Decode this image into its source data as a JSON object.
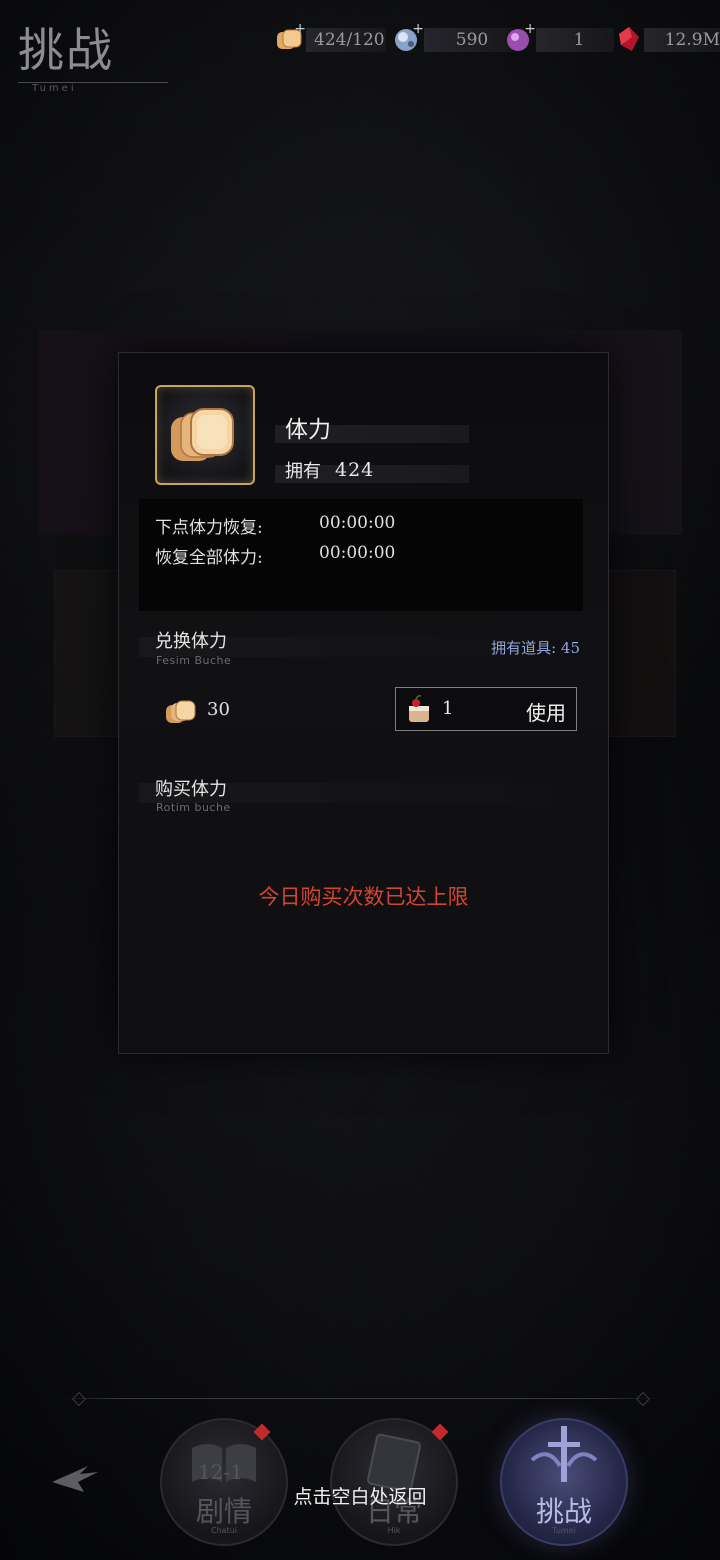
{
  "header": {
    "title": "挑战",
    "subtitle": "Tumei"
  },
  "currencies": [
    {
      "icon": "bread-stamina-icon",
      "value": "424/120"
    },
    {
      "icon": "crystal-orb-icon",
      "value": "590"
    },
    {
      "icon": "purple-gem-icon",
      "value": "1"
    },
    {
      "icon": "red-crystal-icon",
      "value": "12.9M"
    }
  ],
  "modal": {
    "item_icon": "bread-stamina-icon",
    "item_name": "体力",
    "own_label": "拥有",
    "own_value": "424",
    "recovery": {
      "next_label": "下点体力恢复:",
      "next_value": "00:00:00",
      "all_label": "恢复全部体力:",
      "all_value": "00:00:00"
    },
    "exchange": {
      "title": "兑换体力",
      "subtitle": "Fesim Buche",
      "owned_items_label": "拥有道具: 45",
      "amount": "30",
      "item_qty": "1",
      "use_label": "使用"
    },
    "purchase": {
      "title": "购买体力",
      "subtitle": "Rotim buche",
      "limit_message": "今日购买次数已达上限"
    }
  },
  "bottom_nav": {
    "tabs": [
      {
        "label": "剧情",
        "sub": "Chatui",
        "tag": "12-1",
        "active": false
      },
      {
        "label": "日常",
        "sub": "Hik",
        "active": false
      },
      {
        "label": "挑战",
        "sub": "Tumei",
        "active": true
      }
    ],
    "tap_hint": "点击空白处返回"
  },
  "colors": {
    "gold_frame": "#c9a45a",
    "limit_red": "#d4452f",
    "owned_blue": "#8ea6d8"
  }
}
